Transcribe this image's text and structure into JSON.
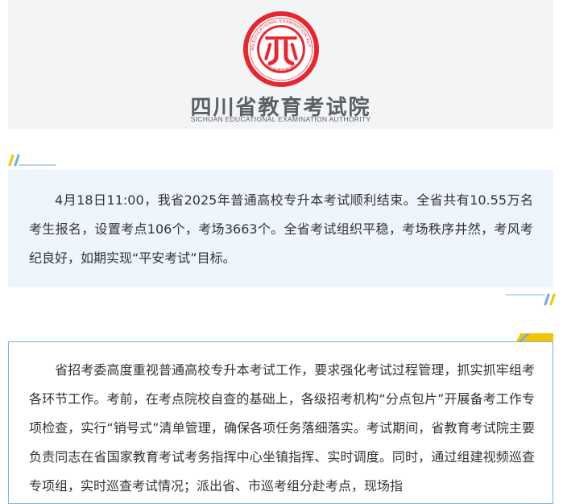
{
  "header": {
    "logo_seal_text": "SICHUAN EDUCATIONAL EXAMINATION AUTHORITY",
    "logo_seal_cn": "四川省教育考试院",
    "org_name_cn": "四川省教育考试院",
    "org_name_en": "SICHUAN EDUCATIONAL EXAMINATION AUTHORITY",
    "brand_color": "#e8262f",
    "text_color": "#5c5f63"
  },
  "summary": {
    "paragraph": "4月18日11:00，我省2025年普通高校专升本考试顺利结束。全省共有10.55万名考生报名，设置考点106个，考场3663个。全省考试组织平稳，考场秩序井然，考风考纪良好，如期实现“平安考试”目标。",
    "background_color": "#eef5fc"
  },
  "detail": {
    "paragraph": "省招考委高度重视普通高校专升本考试工作，要求强化考试过程管理，抓实抓牢组考各环节工作。考前，在考点院校自查的基础上，各级招考机构“分点包片”开展备考工作专项检查，实行“销号式”清单管理，确保各项任务落细落实。考试期间，省教育考试院主要负责同志在省国家教育考试考务指挥中心坐镇指挥、实时调度。同时，通过组建视频巡查专项组，实时巡查考试情况；派出省、市巡考组分赴考点，现场指",
    "border_color": "#77b3e3"
  },
  "decor": {
    "accent_yellow": "#f5c400",
    "accent_blue": "#6fb0e2"
  }
}
